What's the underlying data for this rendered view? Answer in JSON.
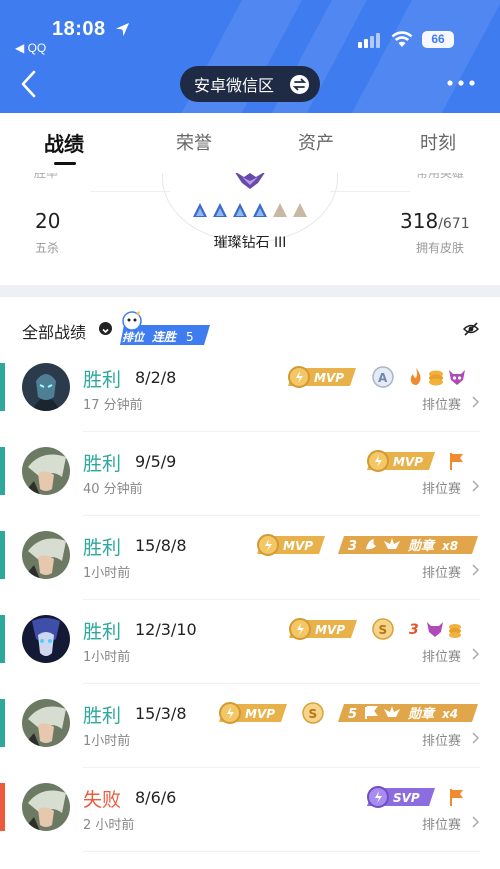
{
  "status_bar": {
    "time": "18:08",
    "back_app": "◀ QQ",
    "battery": "66"
  },
  "header": {
    "zone_label": "安卓微信区"
  },
  "tabs": [
    {
      "label": "战绩",
      "active": true
    },
    {
      "label": "荣誉",
      "active": false
    },
    {
      "label": "资产",
      "active": false
    },
    {
      "label": "时刻",
      "active": false
    }
  ],
  "summary": {
    "left_cut_label": "胜率",
    "right_cut_label": "常用英雄",
    "pentakills_value": "20",
    "pentakills_label": "五杀",
    "rank_name": "璀璨钻石 III",
    "rank_stars_lit": 4,
    "rank_stars_total": 6,
    "skins_owned": "318",
    "skins_total": "/671",
    "skins_label": "拥有皮肤"
  },
  "list": {
    "filter_label": "全部战绩",
    "streak_mode": "排位",
    "streak_label": "连胜",
    "streak_count": "5"
  },
  "matches": [
    {
      "result": "胜利",
      "win": true,
      "kda": "8/2/8",
      "time_ago": "17 分钟前",
      "mode": "排位赛",
      "hero": "dark-armored",
      "mvp": "MVP",
      "extras": [
        "A-badge",
        "flame-icon",
        "coins-icon",
        "demon-icon"
      ]
    },
    {
      "result": "胜利",
      "win": true,
      "kda": "9/5/9",
      "time_ago": "40 分钟前",
      "mode": "排位赛",
      "hero": "silver-hair",
      "mvp": "MVP",
      "extras": [
        "flag-icon"
      ]
    },
    {
      "result": "胜利",
      "win": true,
      "kda": "15/8/8",
      "time_ago": "1小时前",
      "mode": "排位赛",
      "hero": "silver-hair",
      "mvp": "MVP",
      "medal_text": "3",
      "medal_label": "勋章",
      "medal_count": "x8"
    },
    {
      "result": "胜利",
      "win": true,
      "kda": "12/3/10",
      "time_ago": "1小时前",
      "mode": "排位赛",
      "hero": "blue-spirit",
      "mvp": "MVP",
      "s_badge": "S",
      "extras_text": "3",
      "extras": [
        "demon-icon",
        "coins-icon"
      ]
    },
    {
      "result": "胜利",
      "win": true,
      "kda": "15/3/8",
      "time_ago": "1小时前",
      "mode": "排位赛",
      "hero": "silver-hair",
      "mvp": "MVP",
      "s_badge": "S",
      "medal_text": "5",
      "medal_label": "勋章",
      "medal_count": "x4"
    },
    {
      "result": "失败",
      "win": false,
      "kda": "8/6/6",
      "time_ago": "2 小时前",
      "mode": "排位赛",
      "hero": "silver-hair",
      "svp": "SVP",
      "extras": [
        "flag-icon"
      ]
    }
  ],
  "colors": {
    "header_blue": "#3f7cf0",
    "win": "#2ea89c",
    "loss": "#ee5b3c",
    "gold": "#e8b14a",
    "purple": "#8d6ce0"
  }
}
